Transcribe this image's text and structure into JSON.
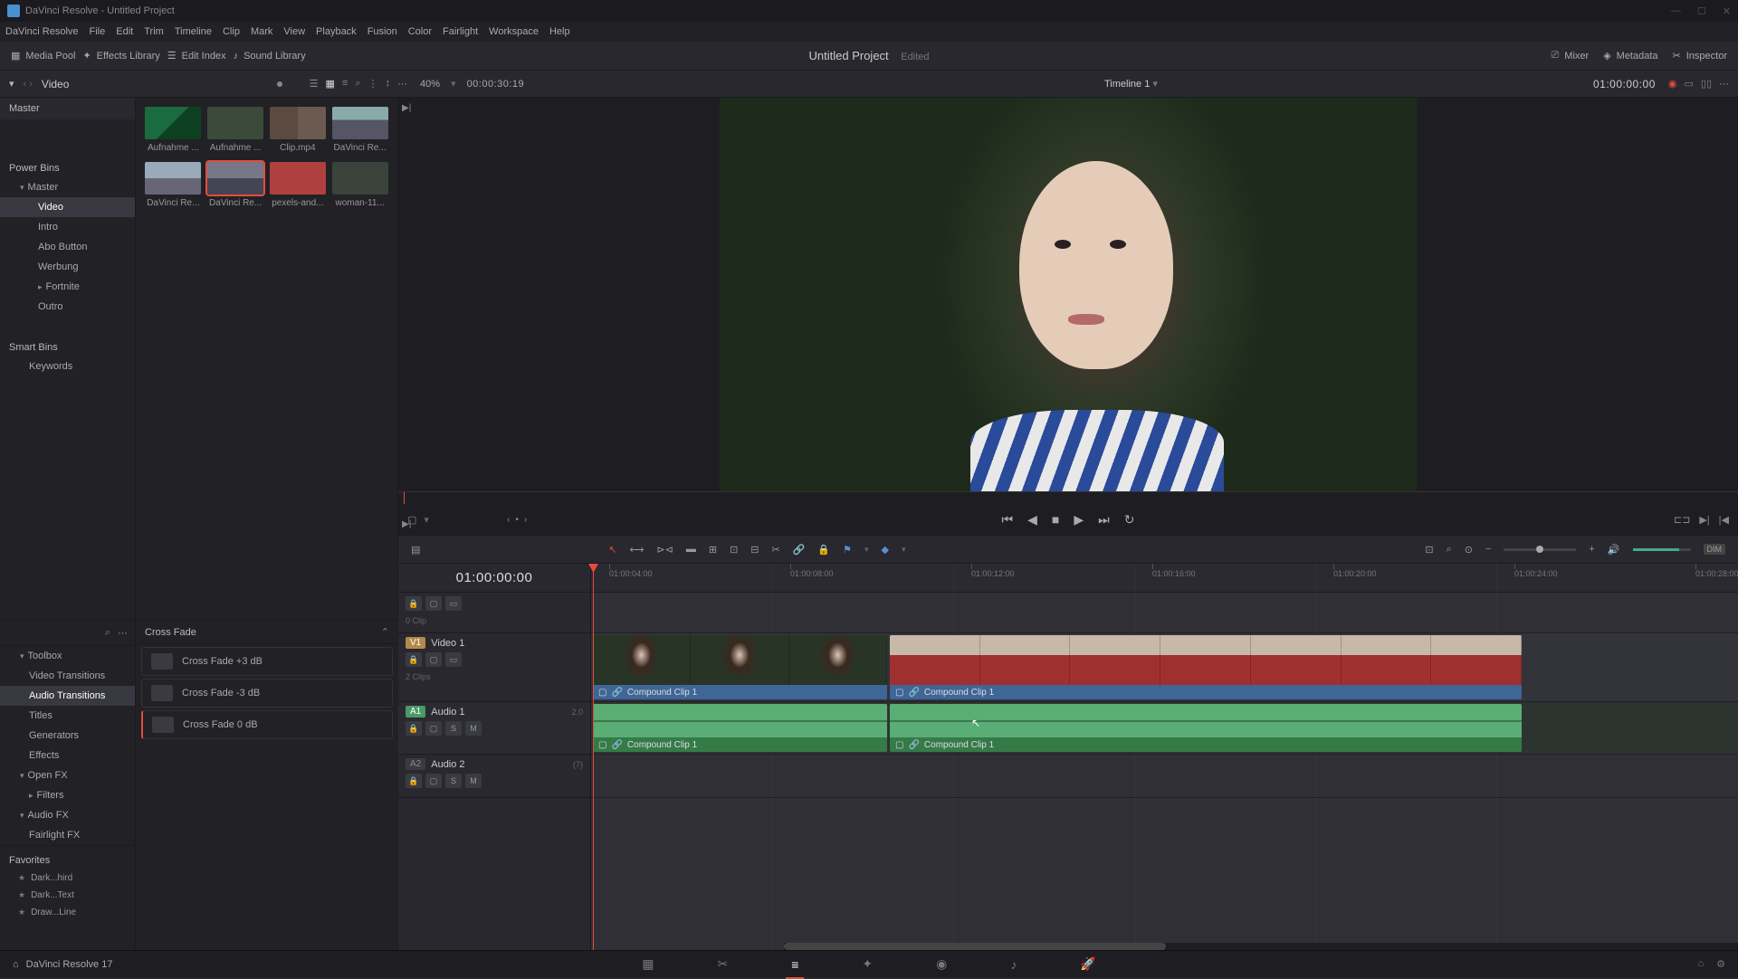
{
  "app": {
    "title": "DaVinci Resolve - Untitled Project",
    "version": "DaVinci Resolve 17"
  },
  "menu": [
    "DaVinci Resolve",
    "File",
    "Edit",
    "Trim",
    "Timeline",
    "Clip",
    "Mark",
    "View",
    "Playback",
    "Fusion",
    "Color",
    "Fairlight",
    "Workspace",
    "Help"
  ],
  "toolbar": {
    "media_pool": "Media Pool",
    "effects_library": "Effects Library",
    "edit_index": "Edit Index",
    "sound_library": "Sound Library",
    "project_title": "Untitled Project",
    "edited": "Edited",
    "mixer": "Mixer",
    "metadata": "Metadata",
    "inspector": "Inspector"
  },
  "secbar": {
    "bin": "Video",
    "zoom": "40%",
    "src_tc": "00:00:30:19",
    "timeline_name": "Timeline 1",
    "rec_tc": "01:00:00:00"
  },
  "bins": {
    "root": "Master",
    "power": "Power Bins",
    "master": "Master",
    "items": [
      "Video",
      "Intro",
      "Abo Button",
      "Werbung",
      "Fortnite",
      "Outro"
    ],
    "smart": "Smart Bins",
    "keywords": "Keywords"
  },
  "clips": [
    {
      "label": "Aufnahme ...",
      "cls": "thumb-green"
    },
    {
      "label": "Aufnahme ...",
      "cls": "thumb-face"
    },
    {
      "label": "Clip.mp4",
      "cls": "thumb-two"
    },
    {
      "label": "DaVinci Re...",
      "cls": "thumb-drone"
    },
    {
      "label": "DaVinci Re...",
      "cls": "thumb-land"
    },
    {
      "label": "DaVinci Re...",
      "cls": "thumb-hdr",
      "sel": true
    },
    {
      "label": "pexels-and...",
      "cls": "thumb-red"
    },
    {
      "label": "woman-11...",
      "cls": "thumb-port"
    }
  ],
  "fx": {
    "toolbox": "Toolbox",
    "cats": [
      "Video Transitions",
      "Audio Transitions",
      "Titles",
      "Generators",
      "Effects"
    ],
    "sel_cat": "Audio Transitions",
    "openfx": "Open FX",
    "filters": "Filters",
    "audiofx": "Audio FX",
    "fairlight": "Fairlight FX",
    "header": "Cross Fade",
    "items": [
      "Cross Fade +3 dB",
      "Cross Fade -3 dB",
      "Cross Fade 0 dB"
    ],
    "favorites": "Favorites",
    "favs": [
      "Dark...hird",
      "Dark...Text",
      "Draw...Line"
    ]
  },
  "timeline": {
    "tc": "01:00:00:00",
    "ticks": [
      "01:00:04:00",
      "01:00:08:00",
      "01:00:12:00",
      "01:00:16:00",
      "01:00:20:00",
      "01:00:24:00",
      "01:00:28:00"
    ],
    "v1": {
      "badge": "V1",
      "name": "Video 1",
      "clips_meta": "2 Clips"
    },
    "v2": {
      "clips_meta": "0 Clip"
    },
    "a1": {
      "badge": "A1",
      "name": "Audio 1",
      "meta": "2.0"
    },
    "a2": {
      "badge": "A2",
      "name": "Audio 2",
      "meta": "(7)"
    },
    "compound": "Compound Clip 1",
    "dim": "DIM",
    "solo": "S",
    "mute": "M"
  }
}
